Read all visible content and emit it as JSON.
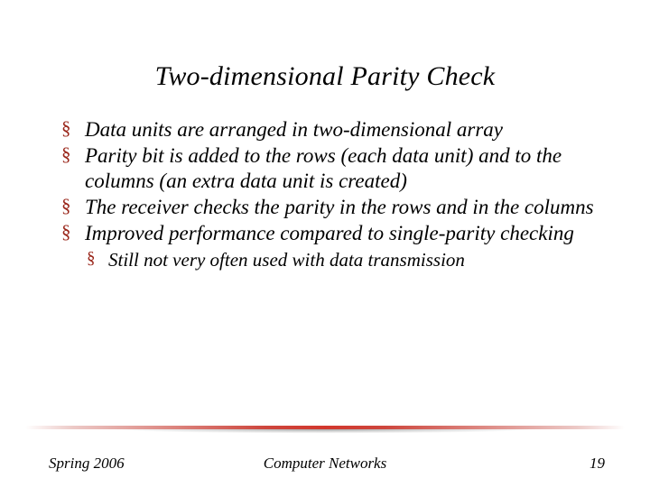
{
  "title": "Two-dimensional Parity Check",
  "bullets": [
    "Data units are arranged in two-dimensional array",
    "Parity bit is added to the rows (each data unit) and to the columns (an extra data unit is created)",
    "The receiver checks the parity in the rows and in the columns",
    "Improved performance compared to single-parity checking"
  ],
  "subbullets_under_last": [
    "Still not very often used with data transmission"
  ],
  "footer": {
    "left": "Spring 2006",
    "center": "Computer Networks",
    "right": "19"
  },
  "colors": {
    "bullet_marker": "#992418",
    "divider": "#c8362a"
  }
}
